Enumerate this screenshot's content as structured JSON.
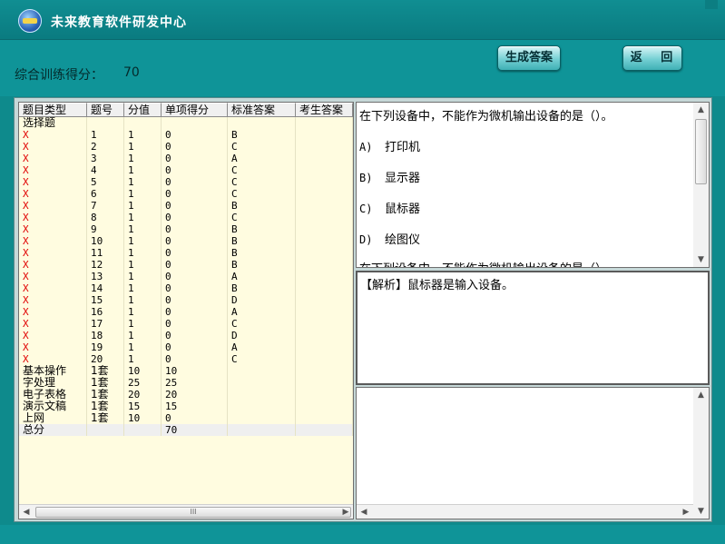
{
  "app": {
    "title": "未来教育软件研发中心"
  },
  "score": {
    "label": "综合训练得分：",
    "value": "70"
  },
  "buttons": {
    "generate": "生成答案",
    "back": "返 回"
  },
  "grid": {
    "headers": [
      "题目类型",
      "题号",
      "分值",
      "单项得分",
      "标准答案",
      "考生答案"
    ],
    "section": "选择题",
    "rows": [
      [
        "X",
        "1",
        "1",
        "0",
        "B",
        ""
      ],
      [
        "X",
        "2",
        "1",
        "0",
        "C",
        ""
      ],
      [
        "X",
        "3",
        "1",
        "0",
        "A",
        ""
      ],
      [
        "X",
        "4",
        "1",
        "0",
        "C",
        ""
      ],
      [
        "X",
        "5",
        "1",
        "0",
        "C",
        ""
      ],
      [
        "X",
        "6",
        "1",
        "0",
        "C",
        ""
      ],
      [
        "X",
        "7",
        "1",
        "0",
        "B",
        ""
      ],
      [
        "X",
        "8",
        "1",
        "0",
        "C",
        ""
      ],
      [
        "X",
        "9",
        "1",
        "0",
        "B",
        ""
      ],
      [
        "X",
        "10",
        "1",
        "0",
        "B",
        ""
      ],
      [
        "X",
        "11",
        "1",
        "0",
        "B",
        ""
      ],
      [
        "X",
        "12",
        "1",
        "0",
        "B",
        ""
      ],
      [
        "X",
        "13",
        "1",
        "0",
        "A",
        ""
      ],
      [
        "X",
        "14",
        "1",
        "0",
        "B",
        ""
      ],
      [
        "X",
        "15",
        "1",
        "0",
        "D",
        ""
      ],
      [
        "X",
        "16",
        "1",
        "0",
        "A",
        ""
      ],
      [
        "X",
        "17",
        "1",
        "0",
        "C",
        ""
      ],
      [
        "X",
        "18",
        "1",
        "0",
        "D",
        ""
      ],
      [
        "X",
        "19",
        "1",
        "0",
        "A",
        ""
      ],
      [
        "X",
        "20",
        "1",
        "0",
        "C",
        ""
      ]
    ],
    "ops": [
      [
        "基本操作",
        "1套",
        "10",
        "10"
      ],
      [
        "字处理",
        "1套",
        "25",
        "25"
      ],
      [
        "电子表格",
        "1套",
        "20",
        "20"
      ],
      [
        "演示文稿",
        "1套",
        "15",
        "15"
      ],
      [
        "上网",
        "1套",
        "10",
        "0"
      ]
    ],
    "total": {
      "label": "总分",
      "value": "70"
    },
    "scroll_thumb": "III"
  },
  "question": {
    "text": "在下列设备中，不能作为微机输出设备的是（）。",
    "options": [
      {
        "letter": "A)",
        "text": "打印机"
      },
      {
        "letter": "B)",
        "text": "显示器"
      },
      {
        "letter": "C)",
        "text": "鼠标器"
      },
      {
        "letter": "D)",
        "text": "绘图仪"
      }
    ],
    "repeat_text": "在下列设备中，不能作为微机输出设备的是（）。"
  },
  "analysis": {
    "text": "【解析】鼠标器是输入设备。"
  },
  "colors": {
    "background": "#0e8a8c",
    "wrong_mark": "#e00000",
    "grid_bg": "#fffce0"
  }
}
